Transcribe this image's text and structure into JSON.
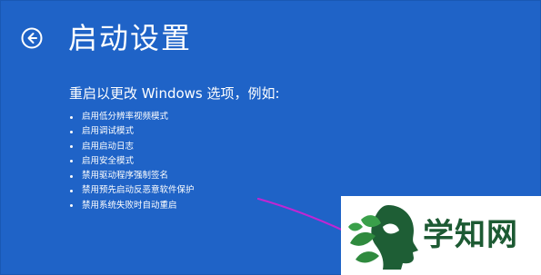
{
  "header": {
    "back_icon": "back-arrow-circle-icon",
    "title": "启动设置"
  },
  "subtitle": "重启以更改 Windows 选项，例如:",
  "options": [
    "启用低分辨率视频模式",
    "启用调试模式",
    "启用启动日志",
    "启用安全模式",
    "禁用驱动程序强制签名",
    "禁用预先启动反恶意软件保护",
    "禁用系统失败时自动重启"
  ],
  "watermark": {
    "text": "学知网",
    "logo_icon": "leaf-head-logo-icon"
  },
  "colors": {
    "background": "#1f63c7",
    "text": "#ffffff",
    "pointer_line": "#c026d3",
    "watermark_text": "#1d5a33"
  }
}
